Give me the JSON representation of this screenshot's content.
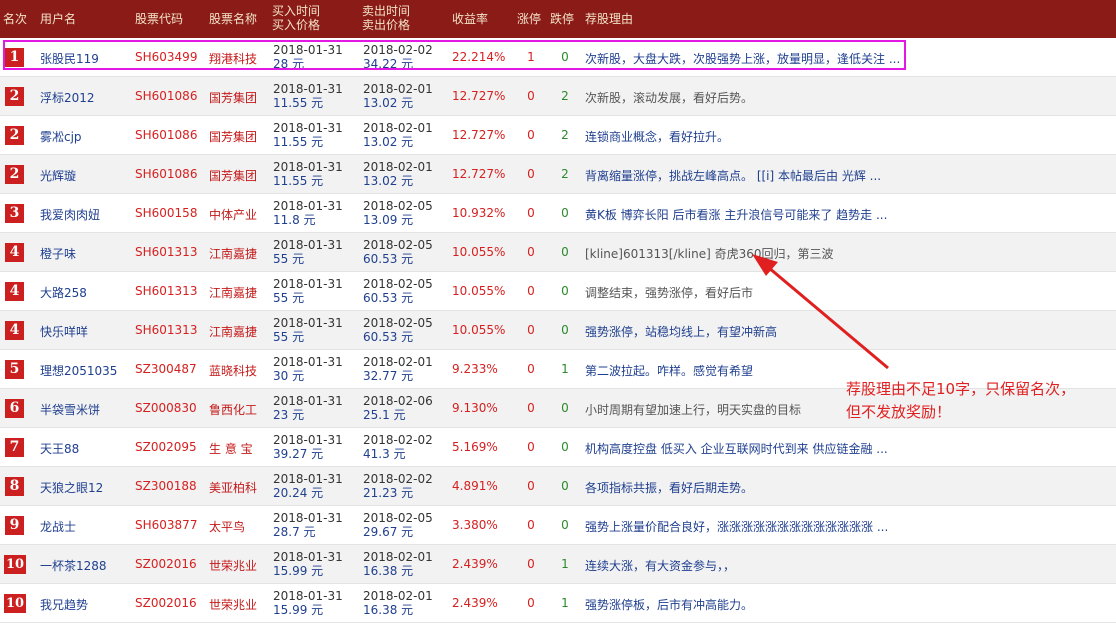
{
  "header": {
    "rank": "名次",
    "user": "用户名",
    "code": "股票代码",
    "name": "股票名称",
    "buy_line1": "买入时间",
    "buy_line2": "买入价格",
    "sell_line1": "卖出时间",
    "sell_line2": "卖出价格",
    "yield": "收益率",
    "zt": "涨停",
    "dt": "跌停",
    "reason": "荐股理由"
  },
  "rows": [
    {
      "rank": "1",
      "user": "张股民119",
      "code": "SH603499",
      "name": "翔港科技",
      "buy_date": "2018-01-31",
      "buy_price": "28 元",
      "sell_date": "2018-02-02",
      "sell_price": "34.22 元",
      "yield": "22.214%",
      "zt": "1",
      "dt": "0",
      "reason": "次新股，大盘大跌，次股强势上涨，放量明显，逢低关注 ..."
    },
    {
      "rank": "2",
      "user": "浮标2012",
      "code": "SH601086",
      "name": "国芳集团",
      "buy_date": "2018-01-31",
      "buy_price": "11.55 元",
      "sell_date": "2018-02-01",
      "sell_price": "13.02 元",
      "yield": "12.727%",
      "zt": "0",
      "dt": "2",
      "reason": "次新股，滚动发展，看好后势。"
    },
    {
      "rank": "2",
      "user": "雾凇cjp",
      "code": "SH601086",
      "name": "国芳集团",
      "buy_date": "2018-01-31",
      "buy_price": "11.55 元",
      "sell_date": "2018-02-01",
      "sell_price": "13.02 元",
      "yield": "12.727%",
      "zt": "0",
      "dt": "2",
      "reason": "连锁商业概念，看好拉升。"
    },
    {
      "rank": "2",
      "user": "光辉璇",
      "code": "SH601086",
      "name": "国芳集团",
      "buy_date": "2018-01-31",
      "buy_price": "11.55 元",
      "sell_date": "2018-02-01",
      "sell_price": "13.02 元",
      "yield": "12.727%",
      "zt": "0",
      "dt": "2",
      "reason": "背离缩量涨停，挑战左峰高点。 [[i] 本帖最后由 光辉 ..."
    },
    {
      "rank": "3",
      "user": "我爱肉肉妞",
      "code": "SH600158",
      "name": "中体产业",
      "buy_date": "2018-01-31",
      "buy_price": "11.8 元",
      "sell_date": "2018-02-05",
      "sell_price": "13.09 元",
      "yield": "10.932%",
      "zt": "0",
      "dt": "0",
      "reason": "黄K板 博弈长阳 后市看涨 主升浪信号可能来了 趋势走 ..."
    },
    {
      "rank": "4",
      "user": "橙子味",
      "code": "SH601313",
      "name": "江南嘉捷",
      "buy_date": "2018-01-31",
      "buy_price": "55 元",
      "sell_date": "2018-02-05",
      "sell_price": "60.53 元",
      "yield": "10.055%",
      "zt": "0",
      "dt": "0",
      "reason": "[kline]601313[/kline] 奇虎360回归，第三波"
    },
    {
      "rank": "4",
      "user": "大路258",
      "code": "SH601313",
      "name": "江南嘉捷",
      "buy_date": "2018-01-31",
      "buy_price": "55 元",
      "sell_date": "2018-02-05",
      "sell_price": "60.53 元",
      "yield": "10.055%",
      "zt": "0",
      "dt": "0",
      "reason": "调整结束，强势涨停，看好后市"
    },
    {
      "rank": "4",
      "user": "快乐咩咩",
      "code": "SH601313",
      "name": "江南嘉捷",
      "buy_date": "2018-01-31",
      "buy_price": "55 元",
      "sell_date": "2018-02-05",
      "sell_price": "60.53 元",
      "yield": "10.055%",
      "zt": "0",
      "dt": "0",
      "reason": "强势涨停，站稳均线上，有望冲新高"
    },
    {
      "rank": "5",
      "user": "理想2051035",
      "code": "SZ300487",
      "name": "蓝晓科技",
      "buy_date": "2018-01-31",
      "buy_price": "30 元",
      "sell_date": "2018-02-01",
      "sell_price": "32.77 元",
      "yield": "9.233%",
      "zt": "0",
      "dt": "1",
      "reason": "第二波拉起。咋样。感觉有希望"
    },
    {
      "rank": "6",
      "user": "半袋雪米饼",
      "code": "SZ000830",
      "name": "鲁西化工",
      "buy_date": "2018-01-31",
      "buy_price": "23 元",
      "sell_date": "2018-02-06",
      "sell_price": "25.1 元",
      "yield": "9.130%",
      "zt": "0",
      "dt": "0",
      "reason": "小时周期有望加速上行，明天实盘的目标"
    },
    {
      "rank": "7",
      "user": "天王88",
      "code": "SZ002095",
      "name": "生 意 宝",
      "buy_date": "2018-01-31",
      "buy_price": "39.27 元",
      "sell_date": "2018-02-02",
      "sell_price": "41.3 元",
      "yield": "5.169%",
      "zt": "0",
      "dt": "0",
      "reason": "机构高度控盘 低买入 企业互联网时代到来 供应链金融 ..."
    },
    {
      "rank": "8",
      "user": "天狼之眼12",
      "code": "SZ300188",
      "name": "美亚柏科",
      "buy_date": "2018-01-31",
      "buy_price": "20.24 元",
      "sell_date": "2018-02-02",
      "sell_price": "21.23 元",
      "yield": "4.891%",
      "zt": "0",
      "dt": "0",
      "reason": "各项指标共振，看好后期走势。"
    },
    {
      "rank": "9",
      "user": "龙战士",
      "code": "SH603877",
      "name": "太平鸟",
      "buy_date": "2018-01-31",
      "buy_price": "28.7 元",
      "sell_date": "2018-02-05",
      "sell_price": "29.67 元",
      "yield": "3.380%",
      "zt": "0",
      "dt": "0",
      "reason": "强势上涨量价配合良好，涨涨涨涨涨涨涨涨涨涨涨涨涨 ..."
    },
    {
      "rank": "10",
      "user": "一杯茶1288",
      "code": "SZ002016",
      "name": "世荣兆业",
      "buy_date": "2018-01-31",
      "buy_price": "15.99 元",
      "sell_date": "2018-02-01",
      "sell_price": "16.38 元",
      "yield": "2.439%",
      "zt": "0",
      "dt": "1",
      "reason": "连续大涨，有大资金参与，，"
    },
    {
      "rank": "10",
      "user": "我兄趋势",
      "code": "SZ002016",
      "name": "世荣兆业",
      "buy_date": "2018-01-31",
      "buy_price": "15.99 元",
      "sell_date": "2018-02-01",
      "sell_price": "16.38 元",
      "yield": "2.439%",
      "zt": "0",
      "dt": "1",
      "reason": "强势涨停板，后市有冲高能力。"
    }
  ],
  "annotation": {
    "line1": "荐股理由不足10字，只保留名次，",
    "line2": "但不发放奖励！"
  },
  "colors": {
    "header_bg": "#8a1b17",
    "rank_badge": "#cc1f1f",
    "highlight_border": "#e418e4",
    "annotation": "#e02020"
  }
}
